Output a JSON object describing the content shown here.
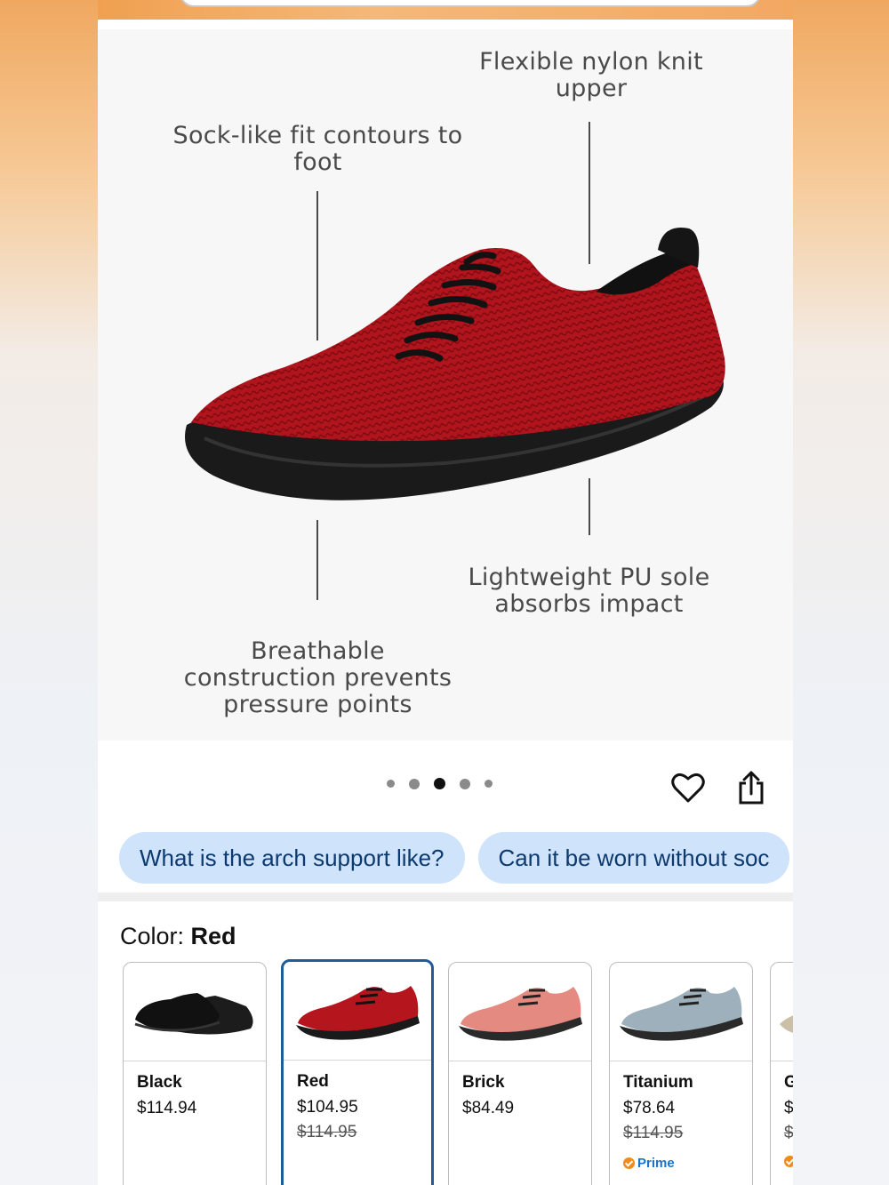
{
  "hero": {
    "callouts": {
      "upper": "Flexible nylon knit\nupper",
      "fit": "Sock-like fit contours to\nfoot",
      "sole": "Lightweight PU sole\nabsorbs impact",
      "breathable": "Breathable\nconstruction prevents\npressure points"
    },
    "carousel": {
      "total": 5,
      "active_index": 2
    }
  },
  "actions": {
    "favorite_icon": "heart-icon",
    "share_icon": "share-icon"
  },
  "questions": [
    "What is the arch support like?",
    "Can it be worn without soc"
  ],
  "color": {
    "label": "Color: ",
    "selected": "Red"
  },
  "swatches": [
    {
      "name": "Black",
      "price": "$114.94",
      "list_price": "",
      "prime": ""
    },
    {
      "name": "Red",
      "price": "$104.95",
      "list_price": "$114.95",
      "prime": ""
    },
    {
      "name": "Brick",
      "price": "$84.49",
      "list_price": "",
      "prime": ""
    },
    {
      "name": "Titanium",
      "price": "$78.64",
      "list_price": "$114.95",
      "prime": "Prime"
    },
    {
      "name": "G",
      "price": "$",
      "list_price": "$",
      "prime": ""
    }
  ],
  "colors": {
    "accent": "#1f5c99",
    "chip_bg": "#cfe3fb",
    "chip_text": "#0d3a6e",
    "prime": "#1a73c8"
  }
}
